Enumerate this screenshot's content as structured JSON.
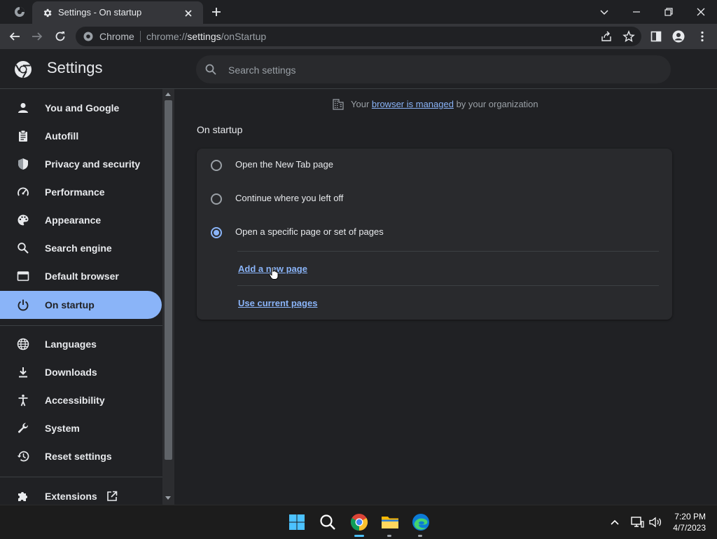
{
  "tab": {
    "title": "Settings - On startup"
  },
  "omnibox": {
    "site_label": "Chrome",
    "url_scheme": "chrome://",
    "url_host": "settings",
    "url_path": "/onStartup"
  },
  "header": {
    "title": "Settings",
    "search_placeholder": "Search settings"
  },
  "sidebar": {
    "items": [
      {
        "label": "You and Google",
        "icon": "person-icon"
      },
      {
        "label": "Autofill",
        "icon": "clipboard-icon"
      },
      {
        "label": "Privacy and security",
        "icon": "shield-icon"
      },
      {
        "label": "Performance",
        "icon": "speedometer-icon"
      },
      {
        "label": "Appearance",
        "icon": "palette-icon"
      },
      {
        "label": "Search engine",
        "icon": "search-icon"
      },
      {
        "label": "Default browser",
        "icon": "browser-window-icon"
      },
      {
        "label": "On startup",
        "icon": "power-icon",
        "selected": true
      },
      {
        "label": "Languages",
        "icon": "globe-icon"
      },
      {
        "label": "Downloads",
        "icon": "download-icon"
      },
      {
        "label": "Accessibility",
        "icon": "accessibility-icon"
      },
      {
        "label": "System",
        "icon": "wrench-icon"
      },
      {
        "label": "Reset settings",
        "icon": "history-icon"
      },
      {
        "label": "Extensions",
        "icon": "puzzle-icon"
      }
    ]
  },
  "main": {
    "managed_notice": {
      "before": "Your ",
      "link": "browser is managed",
      "after": " by your organization"
    },
    "section_title": "On startup",
    "options": [
      {
        "label": "Open the New Tab page",
        "checked": false
      },
      {
        "label": "Continue where you left off",
        "checked": false
      },
      {
        "label": "Open a specific page or set of pages",
        "checked": true
      }
    ],
    "links": {
      "add_page": "Add a new page",
      "use_current": "Use current pages"
    }
  },
  "taskbar": {
    "time": "7:20 PM",
    "date": "4/7/2023"
  },
  "colors": {
    "accent": "#8ab4f8",
    "background": "#202124",
    "card": "#292a2d"
  }
}
